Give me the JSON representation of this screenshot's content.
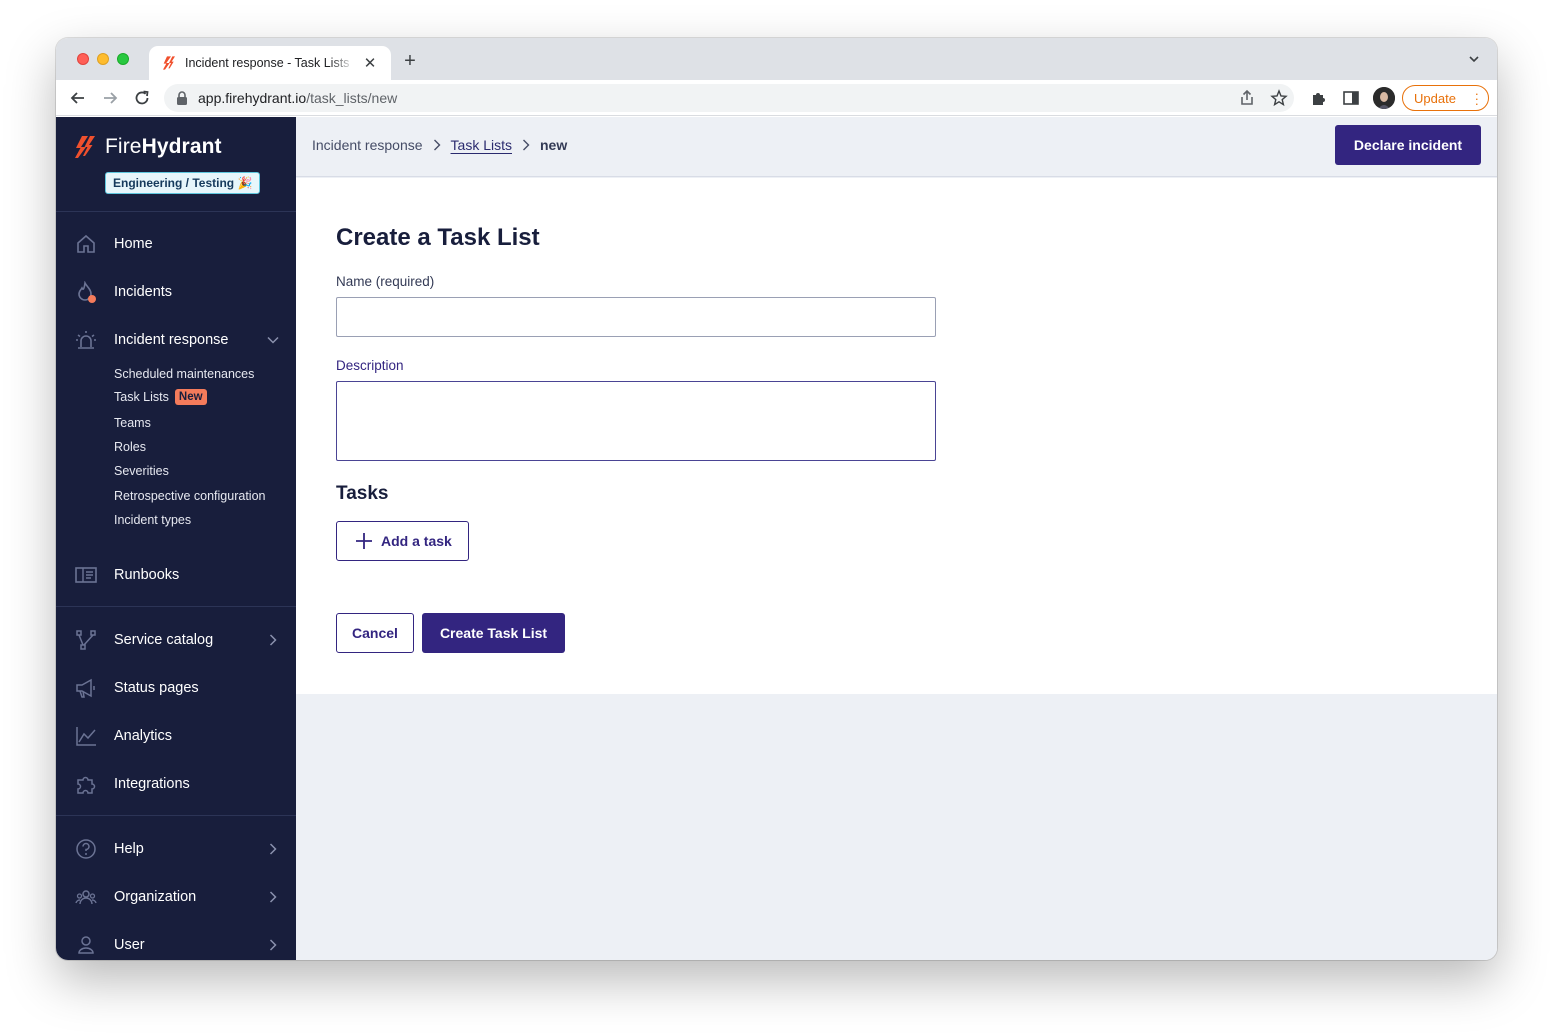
{
  "browser": {
    "tab_title": "Incident response - Task Lists",
    "url_host": "app.firehydrant.io",
    "url_path": "/task_lists/new",
    "update_label": "Update"
  },
  "sidebar": {
    "brand_light": "Fire",
    "brand_bold": "Hydrant",
    "environment_badge": "Engineering / Testing 🎉",
    "items": [
      {
        "label": "Home",
        "icon": "home-icon"
      },
      {
        "label": "Incidents",
        "icon": "flame-icon"
      },
      {
        "label": "Incident response",
        "icon": "siren-icon"
      }
    ],
    "sub_items": [
      {
        "label": "Scheduled maintenances"
      },
      {
        "label": "Task Lists",
        "badge": "New"
      },
      {
        "label": "Teams"
      },
      {
        "label": "Roles"
      },
      {
        "label": "Severities"
      },
      {
        "label": "Retrospective configuration"
      },
      {
        "label": "Incident types"
      }
    ],
    "runbooks": {
      "label": "Runbooks",
      "icon": "book-icon"
    },
    "section2": [
      {
        "label": "Service catalog",
        "icon": "network-icon"
      },
      {
        "label": "Status pages",
        "icon": "megaphone-icon"
      },
      {
        "label": "Analytics",
        "icon": "line-chart-icon"
      },
      {
        "label": "Integrations",
        "icon": "puzzle-icon"
      }
    ],
    "section3": [
      {
        "label": "Help",
        "icon": "question-circle-icon"
      },
      {
        "label": "Organization",
        "icon": "people-icon"
      },
      {
        "label": "User",
        "icon": "user-icon"
      }
    ]
  },
  "header": {
    "breadcrumb": [
      "Incident response",
      "Task Lists",
      "new"
    ],
    "declare_label": "Declare incident"
  },
  "form": {
    "title": "Create a Task List",
    "name_label": "Name (required)",
    "name_value": "",
    "description_label": "Description",
    "description_value": "",
    "tasks_title": "Tasks",
    "add_task_label": "Add a task",
    "cancel_label": "Cancel",
    "submit_label": "Create Task List"
  },
  "colors": {
    "sidebar_bg": "#181e3c",
    "primary": "#332580",
    "accent_orange": "#f47b5b",
    "page_bg": "#edf0f5"
  }
}
